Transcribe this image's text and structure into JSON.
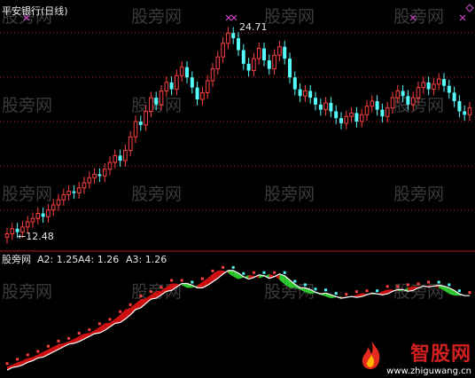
{
  "chart_title": "平安银行(日线)",
  "high_label": "24.71",
  "low_label": "←12.48",
  "indicator": {
    "name": "股旁网",
    "a2": "A2: 1.25",
    "a4": "A4: 1.26",
    "a3": "A3: 1.26"
  },
  "watermark_text": "股旁网",
  "watermark_count": 15,
  "brand": {
    "name": "智股网",
    "url": "www.zhiguwang.cn"
  },
  "colors": {
    "up": "#ff4040",
    "down": "#54fcfc",
    "background": "#000000",
    "grid": "#b01818",
    "signal": "#cc44cc",
    "fill_up": "#d01010",
    "fill_down": "#2ec62e",
    "line": "#ffffff"
  },
  "chart_data": {
    "type": "candlestick",
    "title": "平安银行(日线)",
    "price_range": [
      12.0,
      25.2
    ],
    "annotations": [
      {
        "text": "24.71",
        "kind": "high"
      },
      {
        "text": "12.48",
        "kind": "low"
      }
    ],
    "closes": [
      12.6,
      12.9,
      12.7,
      13.0,
      13.3,
      13.5,
      13.8,
      13.6,
      14.0,
      14.3,
      14.6,
      14.9,
      15.1,
      15.0,
      15.3,
      15.6,
      15.9,
      16.1,
      16.0,
      16.4,
      16.8,
      17.2,
      16.9,
      17.5,
      18.3,
      19.2,
      19.0,
      19.8,
      20.6,
      20.2,
      21.0,
      21.5,
      21.1,
      21.9,
      22.4,
      21.8,
      21.2,
      20.5,
      20.9,
      21.6,
      22.3,
      23.0,
      23.8,
      24.4,
      24.1,
      23.4,
      22.6,
      22.2,
      22.9,
      23.5,
      22.8,
      22.3,
      23.1,
      23.6,
      22.9,
      21.8,
      21.1,
      20.7,
      21.0,
      20.6,
      20.2,
      19.9,
      20.3,
      19.8,
      19.4,
      19.1,
      19.5,
      19.7,
      19.2,
      19.6,
      20.1,
      20.4,
      19.9,
      19.5,
      20.0,
      20.6,
      21.0,
      20.7,
      20.2,
      20.6,
      21.2,
      21.5,
      21.1,
      21.4,
      21.7,
      21.3,
      20.9,
      20.4,
      19.8,
      19.6,
      20.0
    ],
    "indicator_values": [
      0.4,
      0.43,
      0.44,
      0.46,
      0.49,
      0.51,
      0.54,
      0.55,
      0.58,
      0.61,
      0.64,
      0.67,
      0.7,
      0.71,
      0.73,
      0.76,
      0.79,
      0.82,
      0.83,
      0.86,
      0.9,
      0.94,
      0.95,
      0.99,
      1.04,
      1.1,
      1.12,
      1.17,
      1.22,
      1.23,
      1.27,
      1.31,
      1.32,
      1.36,
      1.4,
      1.4,
      1.38,
      1.35,
      1.35,
      1.38,
      1.42,
      1.46,
      1.51,
      1.55,
      1.55,
      1.52,
      1.48,
      1.45,
      1.47,
      1.5,
      1.49,
      1.46,
      1.48,
      1.51,
      1.49,
      1.44,
      1.39,
      1.35,
      1.35,
      1.33,
      1.3,
      1.28,
      1.29,
      1.27,
      1.25,
      1.23,
      1.24,
      1.25,
      1.24,
      1.25,
      1.27,
      1.29,
      1.28,
      1.27,
      1.28,
      1.31,
      1.33,
      1.33,
      1.31,
      1.32,
      1.35,
      1.37,
      1.36,
      1.37,
      1.38,
      1.37,
      1.35,
      1.32,
      1.28,
      1.26,
      1.26
    ],
    "indicator_range": [
      0.35,
      1.6
    ]
  }
}
